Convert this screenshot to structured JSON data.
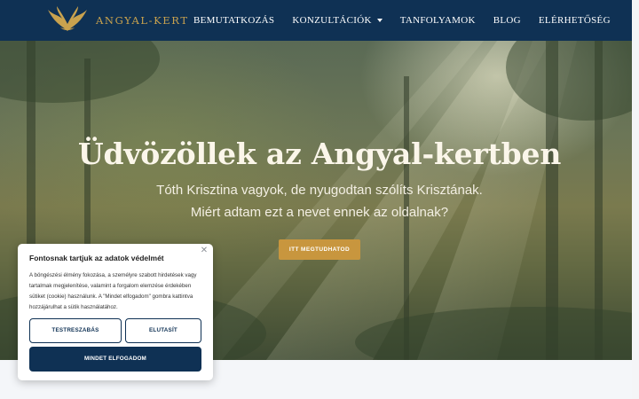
{
  "header": {
    "logo_text": "ANGYAL-KERT",
    "nav": [
      {
        "label": "BEMUTATKOZÁS"
      },
      {
        "label": "KONZULTÁCIÓK"
      },
      {
        "label": "TANFOLYAMOK"
      },
      {
        "label": "BLOG"
      },
      {
        "label": "ELÉRHETŐSÉG"
      }
    ],
    "language_icon": "uk-flag-icon"
  },
  "hero": {
    "title": "Üdvözöllek az Angyal-kertben",
    "subtitle_line1": "Tóth Krisztina vagyok, de nyugodtan szólíts Krisztának.",
    "subtitle_line2": "Miért adtam ezt a nevet ennek az oldalnak?",
    "button_label": "ITT MEGTUDHATOD"
  },
  "cookie": {
    "title": "Fontosnak tartjuk az adatok védelmét",
    "text": "A böngészési élmény fokozása, a személyre szabott hirdetések vagy tartalmak megjelenítése, valamint a forgalom elemzése érdekében sütiket (cookie) használunk. A \"Mindet elfogadom\" gombra kattintva hozzájárulhat a sütik használatához.",
    "customize_label": "TESTRESZABÁS",
    "decline_label": "ELUTASÍT",
    "accept_label": "MINDET ELFOGADOM",
    "close_icon": "close-icon"
  },
  "colors": {
    "header_bg": "#0f3154",
    "accent_gold": "#c8963e",
    "logo_gold": "#c9a24e"
  }
}
